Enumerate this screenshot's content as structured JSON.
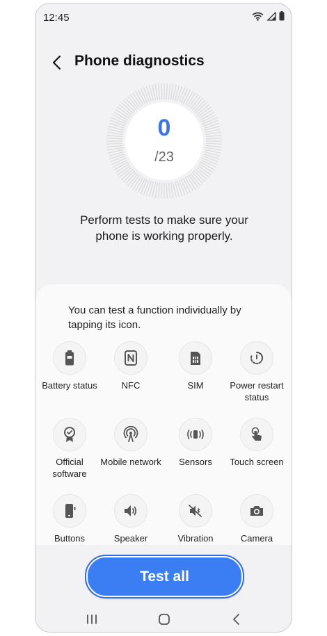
{
  "status_bar": {
    "time": "12:45"
  },
  "header": {
    "title": "Phone diagnostics"
  },
  "progress": {
    "score": "0",
    "total": "/23",
    "fraction": 0
  },
  "intro": "Perform tests to make sure your phone is working properly.",
  "hint": "You can test a function individually by tapping its icon.",
  "tests": [
    {
      "label": "Battery status",
      "icon": "battery-icon"
    },
    {
      "label": "NFC",
      "icon": "nfc-icon"
    },
    {
      "label": "SIM",
      "icon": "sim-card-icon"
    },
    {
      "label": "Power restart status",
      "icon": "power-restart-icon"
    },
    {
      "label": "Official software",
      "icon": "official-software-icon"
    },
    {
      "label": "Mobile network",
      "icon": "mobile-network-icon"
    },
    {
      "label": "Sensors",
      "icon": "sensors-icon"
    },
    {
      "label": "Touch screen",
      "icon": "touch-screen-icon"
    },
    {
      "label": "Buttons",
      "icon": "buttons-icon"
    },
    {
      "label": "Speaker",
      "icon": "speaker-icon"
    },
    {
      "label": "Vibration",
      "icon": "vibration-icon"
    },
    {
      "label": "Camera",
      "icon": "camera-icon"
    }
  ],
  "actions": {
    "test_all": "Test all"
  },
  "colors": {
    "accent": "#3b7df2",
    "score": "#3b74e8",
    "background": "#f2f2f4"
  }
}
